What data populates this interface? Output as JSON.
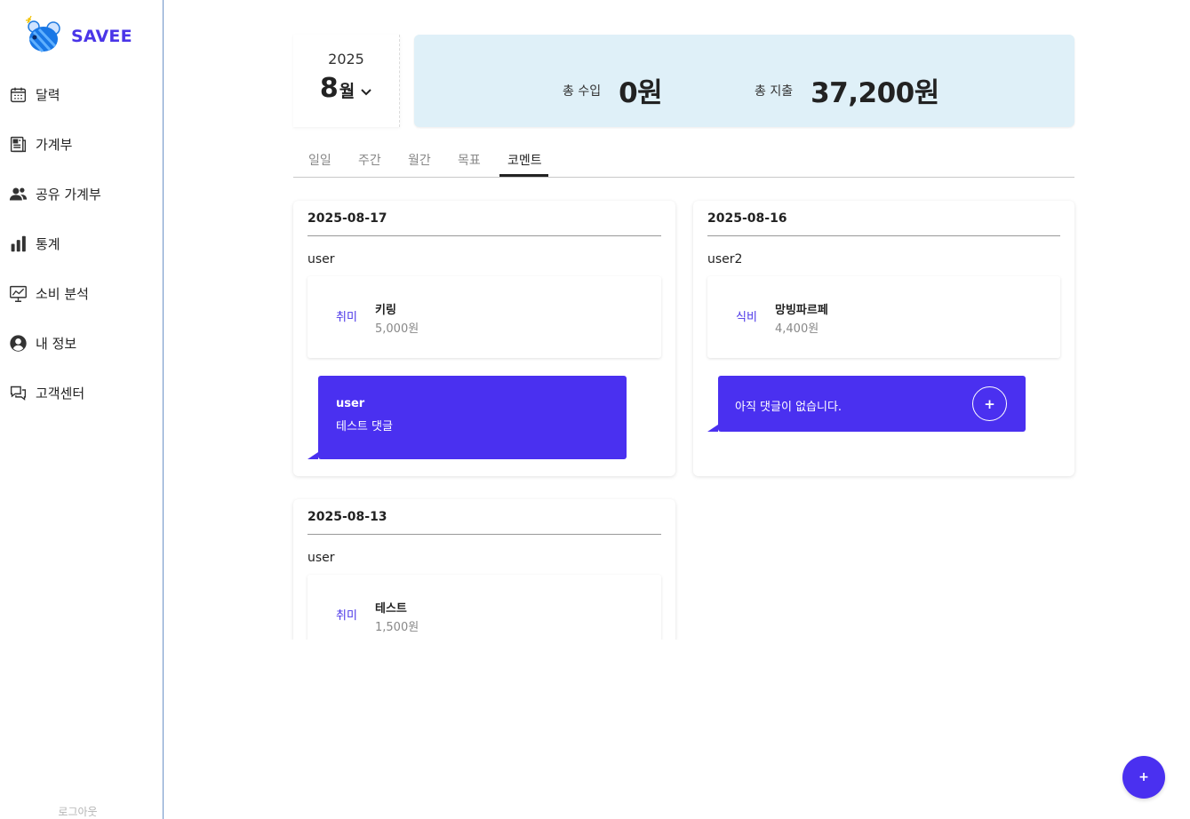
{
  "app": {
    "name": "SAVEE",
    "brand_color": "#4a35e8",
    "accent_color": "#4a30f0"
  },
  "sidebar": {
    "items": [
      {
        "label": "달력",
        "icon": "calendar-icon"
      },
      {
        "label": "가계부",
        "icon": "ledger-icon"
      },
      {
        "label": "공유 가계부",
        "icon": "users-icon"
      },
      {
        "label": "통계",
        "icon": "bar-chart-icon"
      },
      {
        "label": "소비 분석",
        "icon": "analysis-icon"
      },
      {
        "label": "내 정보",
        "icon": "profile-icon"
      },
      {
        "label": "고객센터",
        "icon": "chat-icon"
      }
    ],
    "logout": "로그아웃"
  },
  "period": {
    "year": "2025",
    "month": "8",
    "month_unit": "월"
  },
  "summary": {
    "income_label": "총 수입",
    "income_value": "0원",
    "expense_label": "총 지출",
    "expense_value": "37,200원",
    "bg_color": "#dff0f8"
  },
  "tabs": [
    {
      "label": "일일",
      "active": false
    },
    {
      "label": "주간",
      "active": false
    },
    {
      "label": "월간",
      "active": false
    },
    {
      "label": "목표",
      "active": false
    },
    {
      "label": "코멘트",
      "active": true
    }
  ],
  "comments": [
    {
      "date": "2025-08-17",
      "user": "user",
      "entry": {
        "category": "취미",
        "name": "키링",
        "amount": "5,000원"
      },
      "comment": {
        "user": "user",
        "text": "테스트 댓글"
      }
    },
    {
      "date": "2025-08-16",
      "user": "user2",
      "entry": {
        "category": "식비",
        "name": "망빙파르페",
        "amount": "4,400원"
      },
      "empty_text": "아직 댓글이 없습니다.",
      "add_label": "+"
    },
    {
      "date": "2025-08-13",
      "user": "user",
      "entry": {
        "category": "취미",
        "name": "테스트",
        "amount": "1,500원"
      }
    }
  ],
  "fab_label": "+"
}
